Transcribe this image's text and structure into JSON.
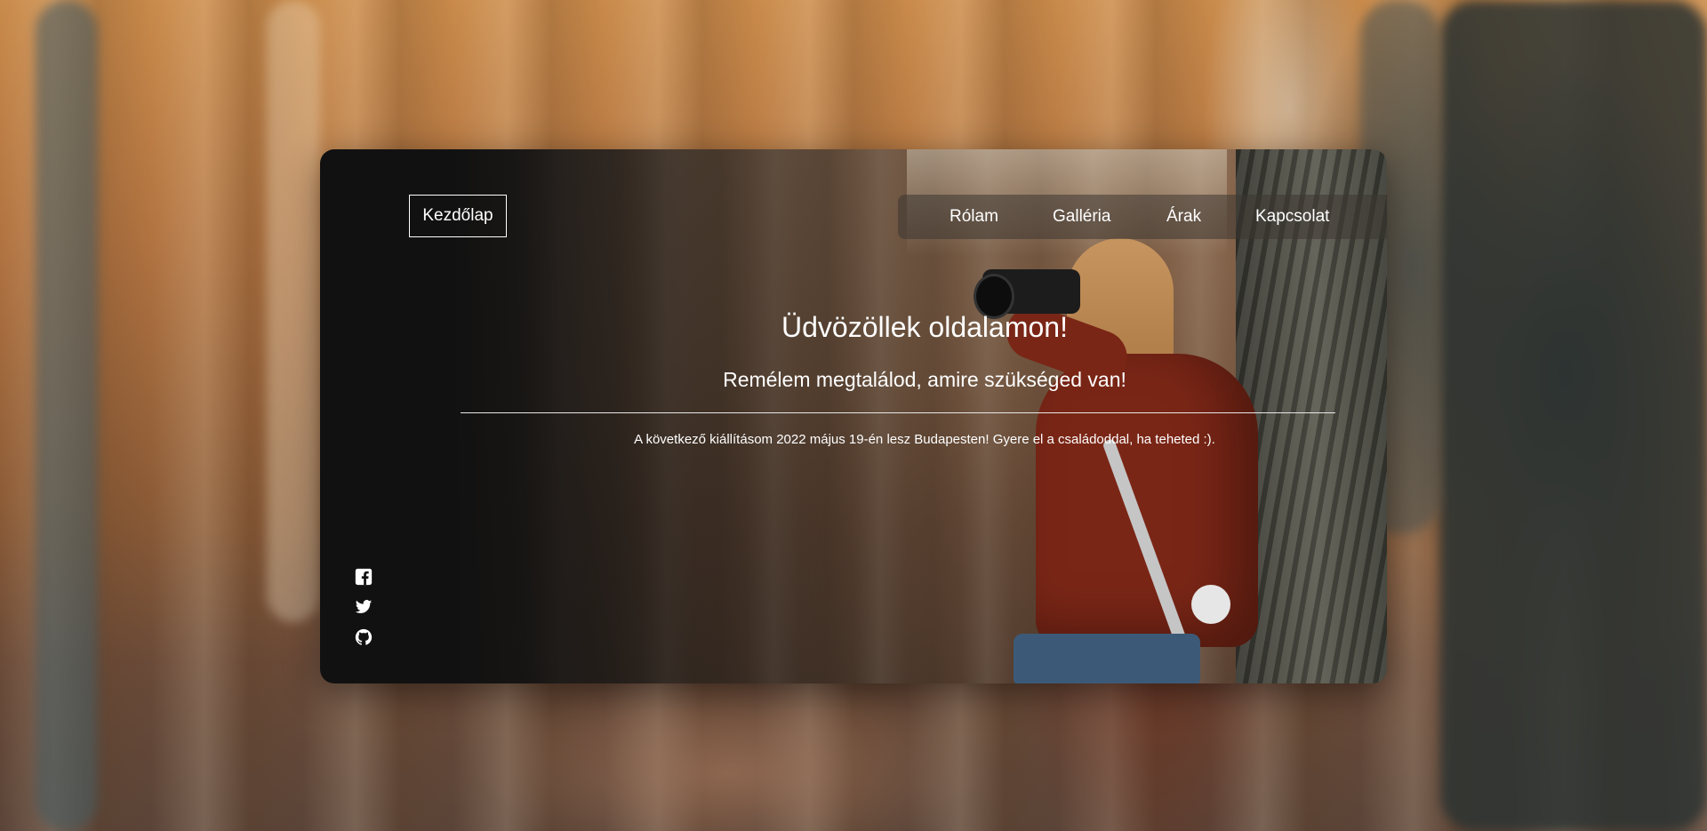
{
  "header": {
    "home_label": "Kezdőlap"
  },
  "nav": {
    "items": [
      {
        "label": "Rólam"
      },
      {
        "label": "Galléria"
      },
      {
        "label": "Árak"
      },
      {
        "label": "Kapcsolat"
      }
    ]
  },
  "hero": {
    "title": "Üdvözöllek oldalamon!",
    "subtitle": "Remélem megtalálod, amire szükséged van!",
    "note": "A következő kiállításom 2022 május 19-én lesz Budapesten! Gyere el a családoddal, ha teheted :)."
  },
  "social": {
    "icons": [
      "facebook-icon",
      "twitter-icon",
      "github-icon"
    ]
  },
  "colors": {
    "text": "#ffffff",
    "card_dark": "#111111",
    "nav_bg": "#3c3732"
  }
}
